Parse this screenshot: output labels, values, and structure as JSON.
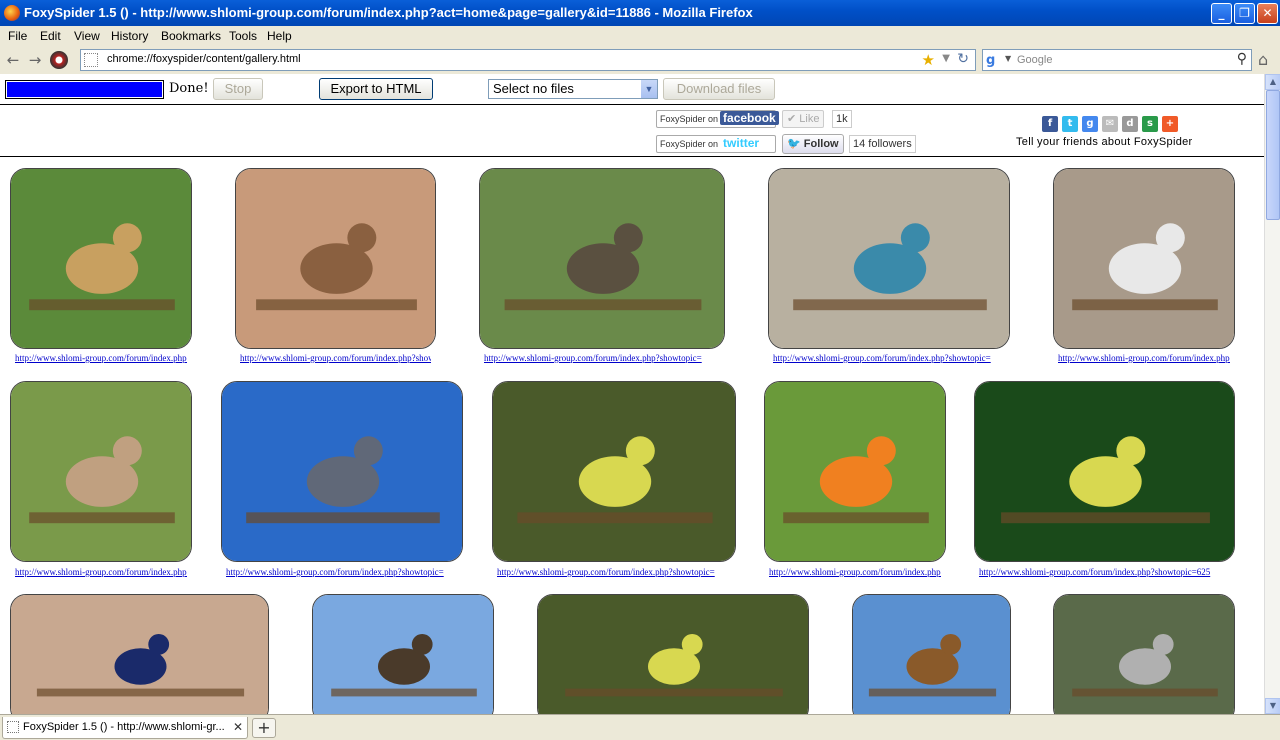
{
  "window": {
    "title": "FoxySpider 1.5 () - http://www.shlomi-group.com/forum/index.php?act=home&page=gallery&id=11886 - Mozilla Firefox",
    "minimize": "_",
    "maximize": "❐",
    "close": "✕"
  },
  "menu": [
    "File",
    "Edit",
    "View",
    "History",
    "Bookmarks",
    "Tools",
    "Help"
  ],
  "nav": {
    "url": "chrome://foxyspider/content/gallery.html",
    "search_placeholder": "Google",
    "back_icon": "←",
    "forward_icon": "→",
    "reload_icon": "↻",
    "star_icon": "★",
    "search_icon": "⚲",
    "home_icon": "⌂"
  },
  "toolbar": {
    "progress": 1.0,
    "status": "Done!",
    "stop": "Stop",
    "export": "Export to HTML",
    "select": "Select no files",
    "download": "Download files"
  },
  "social": {
    "fb_prefix": "FoxySpider on",
    "fb_brand": "facebook",
    "like": "Like",
    "like_count": "1k",
    "tw_prefix": "FoxySpider on",
    "tw_brand": "twitter",
    "follow": "Follow",
    "followers": "14 followers",
    "tell": "Tell your friends about FoxySpider"
  },
  "gallery": {
    "row1": [
      {
        "link": "http://www.shlomi-group.com/forum/index.php?showtopic=",
        "bg": "#5b8a3a",
        "bird": "#c8a060"
      },
      {
        "link": "http://www.shlomi-group.com/forum/index.php?showtopic=",
        "bg": "#c89a7a",
        "bird": "#8a6040"
      },
      {
        "link": "http://www.shlomi-group.com/forum/index.php?showtopic=",
        "bg": "#6a8a4a",
        "bird": "#5a5040"
      },
      {
        "link": "http://www.shlomi-group.com/forum/index.php?showtopic=",
        "bg": "#b8b0a0",
        "bird": "#3a8aaa"
      },
      {
        "link": "http://www.shlomi-group.com/forum/index.php?showtopic=",
        "bg": "#a89a8a",
        "bird": "#e8e8e8"
      }
    ],
    "row2": [
      {
        "link": "http://www.shlomi-group.com/forum/index.php?showtopic=",
        "bg": "#7a9a4a",
        "bird": "#c0a080"
      },
      {
        "link": "http://www.shlomi-group.com/forum/index.php?showtopic=",
        "bg": "#2a6ac8",
        "bird": "#606878"
      },
      {
        "link": "http://www.shlomi-group.com/forum/index.php?showtopic=",
        "bg": "#4a5a2a",
        "bird": "#d8d850"
      },
      {
        "link": "http://www.shlomi-group.com/forum/index.php?showtopic=",
        "bg": "#6a9a3a",
        "bird": "#f08020"
      },
      {
        "link": "http://www.shlomi-group.com/forum/index.php?showtopic=625",
        "bg": "#1a4a1a",
        "bird": "#d8d850"
      }
    ],
    "row3": [
      {
        "bg": "#c8a890",
        "bird": "#1a2a6a"
      },
      {
        "bg": "#7aa8e0",
        "bird": "#4a3a2a"
      },
      {
        "bg": "#4a5a2a",
        "bird": "#d8d850"
      },
      {
        "bg": "#5a90d0",
        "bird": "#8a5a2a"
      },
      {
        "bg": "#5a6a4a",
        "bird": "#b0b0b0"
      }
    ]
  },
  "tab": {
    "label": "FoxySpider 1.5 () - http://www.shlomi-gr...",
    "close": "✕",
    "new": "+"
  }
}
